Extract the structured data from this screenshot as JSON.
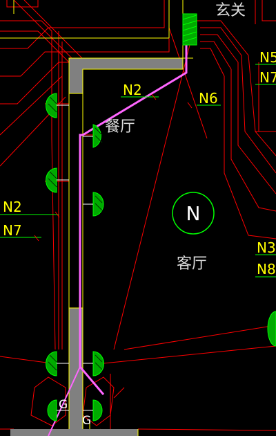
{
  "drawing": {
    "room_labels": {
      "living_room": "客厅",
      "dining_room": "餐厅",
      "entrance": "玄关"
    },
    "north_symbol": "N",
    "circuit_labels": {
      "n2_top": "N2",
      "n6": "N6",
      "n5": "N5",
      "n7_right": "N7",
      "n2_left": "N2",
      "n7_left": "N7",
      "n3": "N3",
      "n8": "N8"
    },
    "fixture_labels": {
      "g_left": "G",
      "g_bottom": "G"
    },
    "colors": {
      "background": "#000000",
      "wall_fill": "#808080",
      "wall_outline": "#ffff00",
      "wiring": "#ff0000",
      "feed_line": "#ff66ff",
      "fixture": "#00cc00",
      "leader": "#00ff00"
    }
  }
}
